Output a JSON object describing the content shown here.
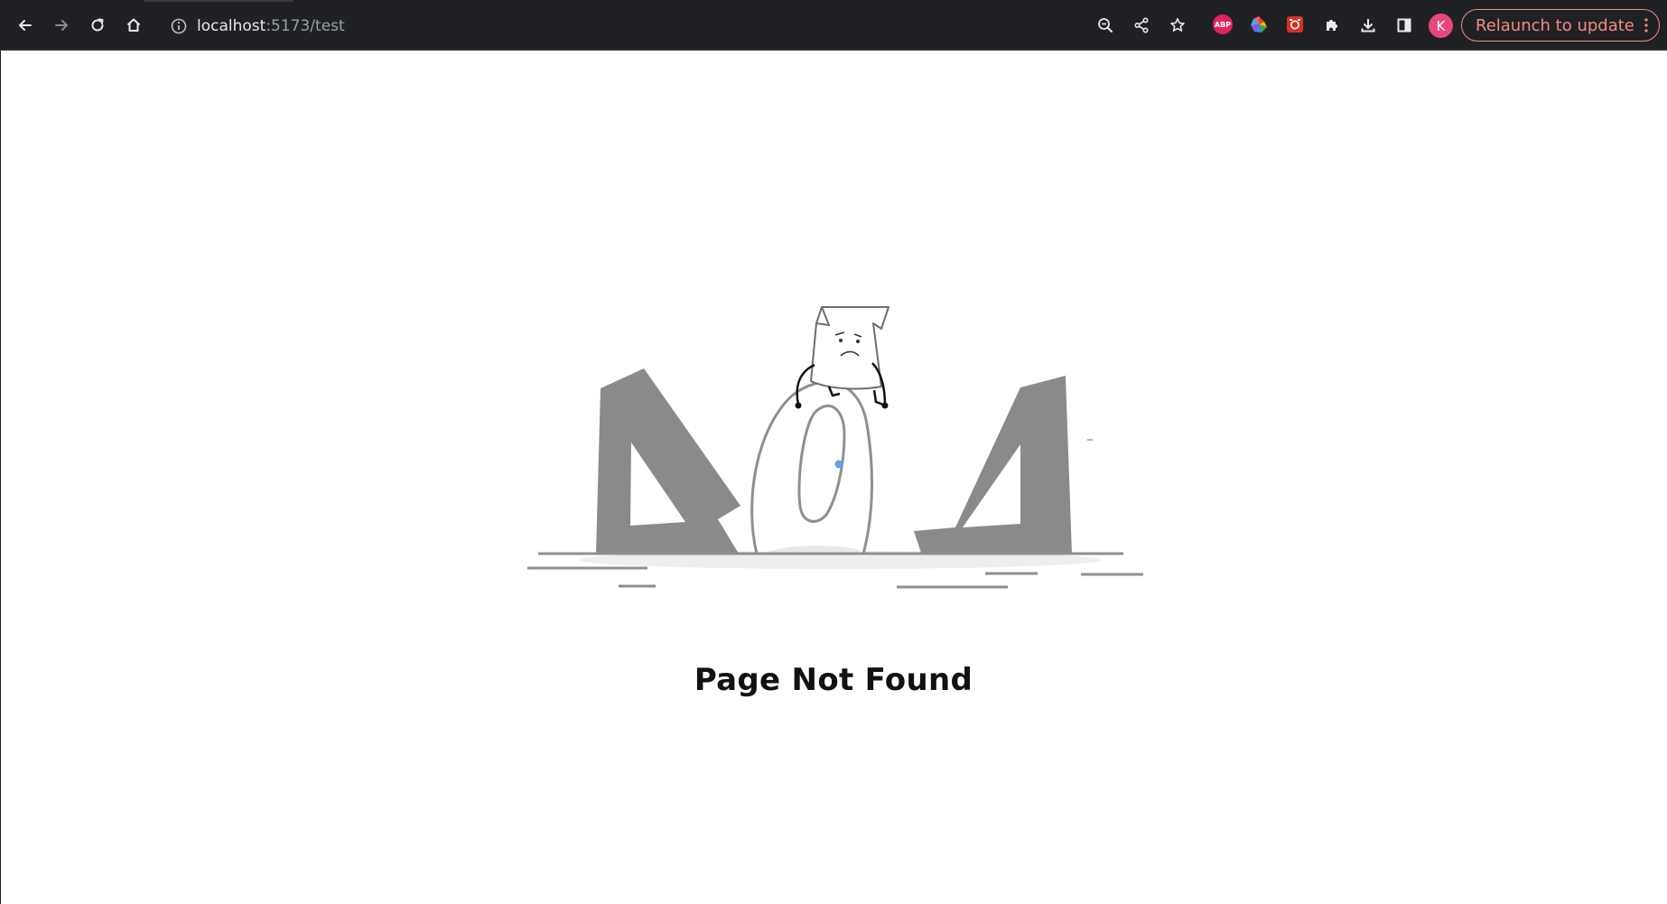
{
  "browser": {
    "url_host": "localhost",
    "url_rest": ":5173/test",
    "avatar_letter": "K",
    "relaunch_label": "Relaunch to update",
    "extensions": [
      {
        "name": "adblock-plus",
        "label": "ABP"
      },
      {
        "name": "color-picker"
      },
      {
        "name": "screenshot-tool"
      }
    ],
    "colors": {
      "toolbar": "#202124",
      "relaunch": "#f28b82",
      "avatar": "#e8477d",
      "abp": "#e0245e"
    }
  },
  "page": {
    "title": "Page Not Found",
    "illustration": "404-sad-paper-character",
    "illustration_text": "404"
  }
}
